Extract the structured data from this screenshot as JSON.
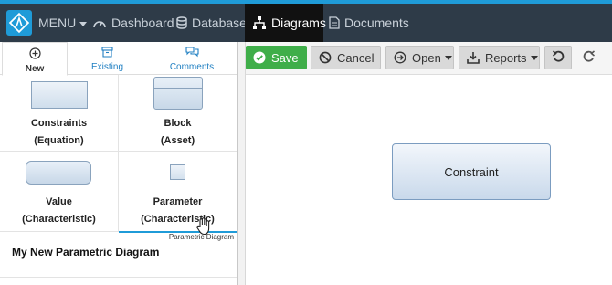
{
  "nav": {
    "menu_label": "MENU",
    "items": [
      {
        "label": "Dashboard",
        "icon": "dashboard-icon"
      },
      {
        "label": "Database",
        "icon": "database-icon"
      },
      {
        "label": "Diagrams",
        "icon": "diagrams-icon",
        "active": true
      },
      {
        "label": "Documents",
        "icon": "document-icon"
      }
    ]
  },
  "left_panel": {
    "tabs": [
      {
        "label": "New",
        "icon": "plus-circle-icon",
        "active": true
      },
      {
        "label": "Existing",
        "icon": "archive-icon"
      },
      {
        "label": "Comments",
        "icon": "comments-icon"
      }
    ],
    "palette": [
      {
        "line1": "Constraints",
        "line2": "(Equation)"
      },
      {
        "line1": "Block",
        "line2": "(Asset)"
      },
      {
        "line1": "Value",
        "line2": "(Characteristic)"
      },
      {
        "line1": "Parameter",
        "line2": "(Characteristic)"
      }
    ],
    "diagram_type": "Parametric Diagram",
    "diagram_name": "My New Parametric Diagram"
  },
  "toolbar": {
    "save_label": "Save",
    "cancel_label": "Cancel",
    "open_label": "Open",
    "reports_label": "Reports"
  },
  "canvas": {
    "node_label": "Constraint"
  },
  "colors": {
    "topbar": "#2e3b48",
    "accent": "#1f9bd8",
    "save": "#3fae49"
  }
}
